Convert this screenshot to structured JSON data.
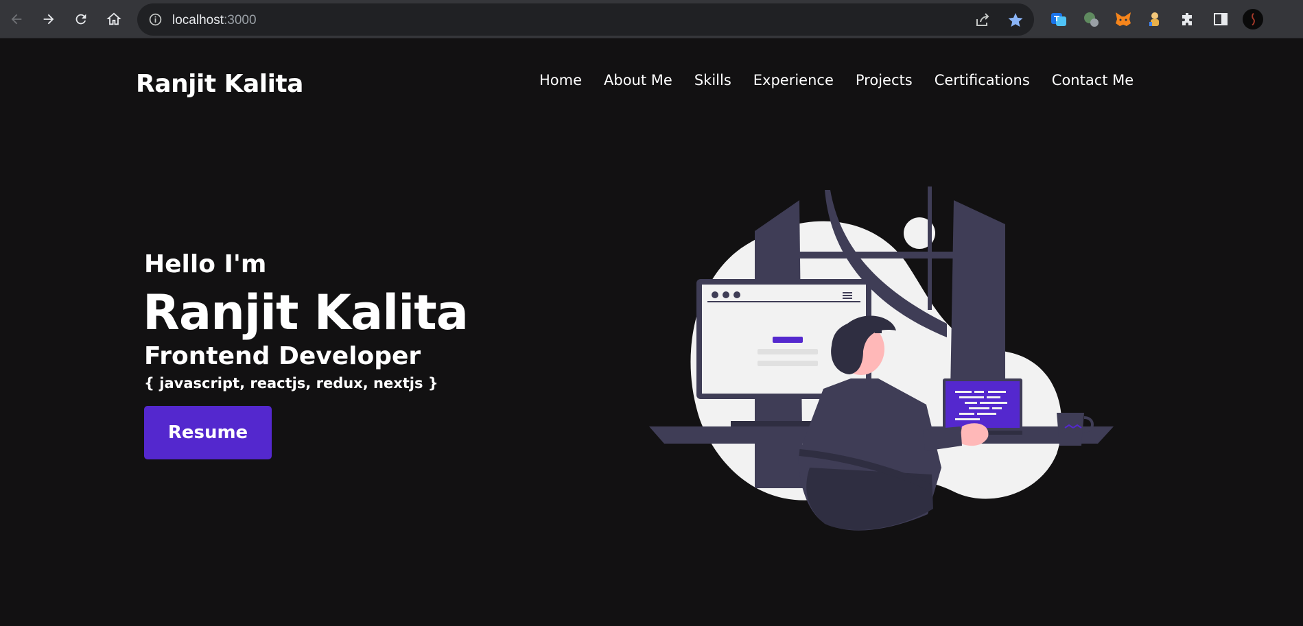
{
  "browser": {
    "url_host": "localhost",
    "url_port": ":3000",
    "icons": [
      "back-icon",
      "forward-icon",
      "reload-icon",
      "home-icon",
      "info-icon",
      "share-icon",
      "bookmark-star-icon",
      "extension-icon",
      "side-panel-icon",
      "profile-avatar"
    ],
    "accent_color": "#8ab4f8"
  },
  "header": {
    "brand": "Ranjit Kalita",
    "nav": [
      "Home",
      "About Me",
      "Skills",
      "Experience",
      "Projects",
      "Certifications",
      "Contact Me"
    ]
  },
  "hero": {
    "greeting": "Hello I'm",
    "name": "Ranjit Kalita",
    "role": "Frontend Developer",
    "stack": "{ javascript, reactjs, redux, nextjs }",
    "resume_label": "Resume",
    "accent_color": "#5428ce"
  }
}
